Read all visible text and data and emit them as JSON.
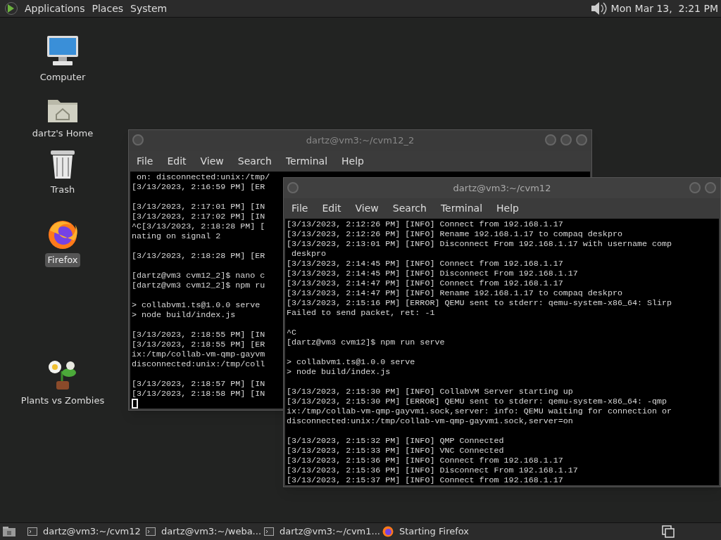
{
  "top_panel": {
    "menus": [
      "Applications",
      "Places",
      "System"
    ],
    "clock": "Mon Mar 13,  2:21 PM"
  },
  "desktop_icons": [
    {
      "kind": "computer",
      "label": "Computer",
      "selected": false
    },
    {
      "kind": "folder",
      "label": "dartz's Home",
      "selected": false
    },
    {
      "kind": "trash",
      "label": "Trash",
      "selected": false
    },
    {
      "kind": "browser",
      "label": "Firefox",
      "selected": true
    },
    {
      "kind": "game",
      "label": "Plants vs Zombies",
      "selected": false
    }
  ],
  "windows": [
    {
      "title": "dartz@vm3:~/cvm12_2",
      "focused": false,
      "menus": [
        "File",
        "Edit",
        "View",
        "Search",
        "Terminal",
        "Help"
      ],
      "cursor": true,
      "blocks": [
        [
          " on: disconnected:unix:/tmp/",
          "[3/13/2023, 2:16:59 PM] [ER"
        ],
        [
          "[3/13/2023, 2:17:01 PM] [IN",
          "[3/13/2023, 2:17:02 PM] [IN",
          "^C[3/13/2023, 2:18:28 PM] [",
          "nating on signal 2"
        ],
        [
          "[3/13/2023, 2:18:28 PM] [ER"
        ],
        [
          "[dartz@vm3 cvm12_2]$ nano c",
          "[dartz@vm3 cvm12_2]$ npm ru"
        ],
        [
          "> collabvm1.ts@1.0.0 serve",
          "> node build/index.js"
        ],
        [
          "[3/13/2023, 2:18:55 PM] [IN",
          "[3/13/2023, 2:18:55 PM] [ER",
          "ix:/tmp/collab-vm-qmp-gayvm",
          "disconnected:unix:/tmp/coll"
        ],
        [
          "[3/13/2023, 2:18:57 PM] [IN",
          "[3/13/2023, 2:18:58 PM] [IN"
        ]
      ]
    },
    {
      "title": "dartz@vm3:~/cvm12",
      "focused": true,
      "menus": [
        "File",
        "Edit",
        "View",
        "Search",
        "Terminal",
        "Help"
      ],
      "cursor": false,
      "blocks": [
        [
          "[3/13/2023, 2:12:26 PM] [INFO] Connect from 192.168.1.17",
          "[3/13/2023, 2:12:26 PM] [INFO] Rename 192.168.1.17 to compaq deskpro",
          "[3/13/2023, 2:13:01 PM] [INFO] Disconnect From 192.168.1.17 with username comp",
          " deskpro",
          "[3/13/2023, 2:14:45 PM] [INFO] Connect from 192.168.1.17",
          "[3/13/2023, 2:14:45 PM] [INFO] Disconnect From 192.168.1.17",
          "[3/13/2023, 2:14:47 PM] [INFO] Connect from 192.168.1.17",
          "[3/13/2023, 2:14:47 PM] [INFO] Rename 192.168.1.17 to compaq deskpro",
          "[3/13/2023, 2:15:16 PM] [ERROR] QEMU sent to stderr: qemu-system-x86_64: Slirp",
          "Failed to send packet, ret: -1"
        ],
        [
          "^C",
          "[dartz@vm3 cvm12]$ npm run serve"
        ],
        [
          "> collabvm1.ts@1.0.0 serve",
          "> node build/index.js"
        ],
        [
          "[3/13/2023, 2:15:30 PM] [INFO] CollabVM Server starting up",
          "[3/13/2023, 2:15:30 PM] [ERROR] QEMU sent to stderr: qemu-system-x86_64: -qmp",
          "ix:/tmp/collab-vm-qmp-gayvm1.sock,server: info: QEMU waiting for connection or",
          "disconnected:unix:/tmp/collab-vm-qmp-gayvm1.sock,server=on"
        ],
        [
          "[3/13/2023, 2:15:32 PM] [INFO] QMP Connected",
          "[3/13/2023, 2:15:33 PM] [INFO] VNC Connected",
          "[3/13/2023, 2:15:36 PM] [INFO] Connect from 192.168.1.17",
          "[3/13/2023, 2:15:36 PM] [INFO] Disconnect From 192.168.1.17",
          "[3/13/2023, 2:15:37 PM] [INFO] Connect from 192.168.1.17"
        ]
      ]
    }
  ],
  "taskbar": {
    "tasks": [
      {
        "kind": "terminal",
        "label": "dartz@vm3:~/cvm12"
      },
      {
        "kind": "terminal",
        "label": "dartz@vm3:~/weba..."
      },
      {
        "kind": "terminal",
        "label": "dartz@vm3:~/cvm1..."
      },
      {
        "kind": "browser",
        "label": "Starting Firefox"
      }
    ]
  }
}
